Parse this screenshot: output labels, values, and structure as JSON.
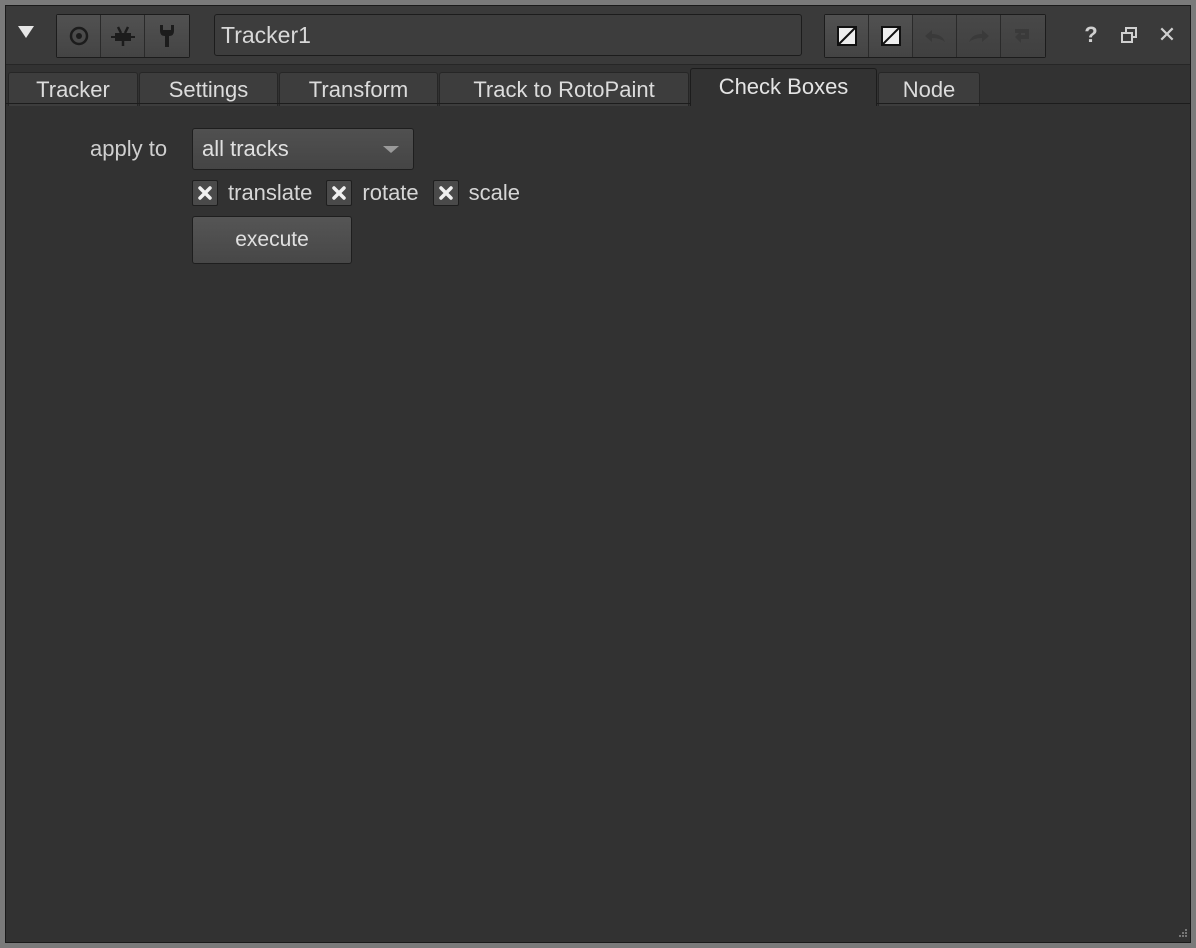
{
  "header": {
    "node_name": "Tracker1",
    "toolbar_icons": [
      "collapse-triangle-icon",
      "viewer-icon",
      "node-center-icon",
      "wrench-icon"
    ],
    "edit_icons": [
      "mask-input-icon",
      "mask-output-icon",
      "undo-icon",
      "redo-icon",
      "revert-icon"
    ],
    "window_icons": {
      "help": "?",
      "float": "float-icon",
      "close": "✕"
    }
  },
  "tabs": [
    {
      "label": "Tracker",
      "active": false
    },
    {
      "label": "Settings",
      "active": false
    },
    {
      "label": "Transform",
      "active": false
    },
    {
      "label": "Track to RotoPaint",
      "active": false
    },
    {
      "label": "Check Boxes",
      "active": true
    },
    {
      "label": "Node",
      "active": false
    }
  ],
  "check_boxes_panel": {
    "apply_to_label": "apply to",
    "apply_to_value": "all tracks",
    "checkboxes": [
      {
        "label": "translate",
        "checked": true
      },
      {
        "label": "rotate",
        "checked": true
      },
      {
        "label": "scale",
        "checked": true
      }
    ],
    "execute_label": "execute"
  },
  "colors": {
    "panel_bg": "#323232",
    "frame": "#7a7a7a",
    "text": "#d6d6d6"
  }
}
